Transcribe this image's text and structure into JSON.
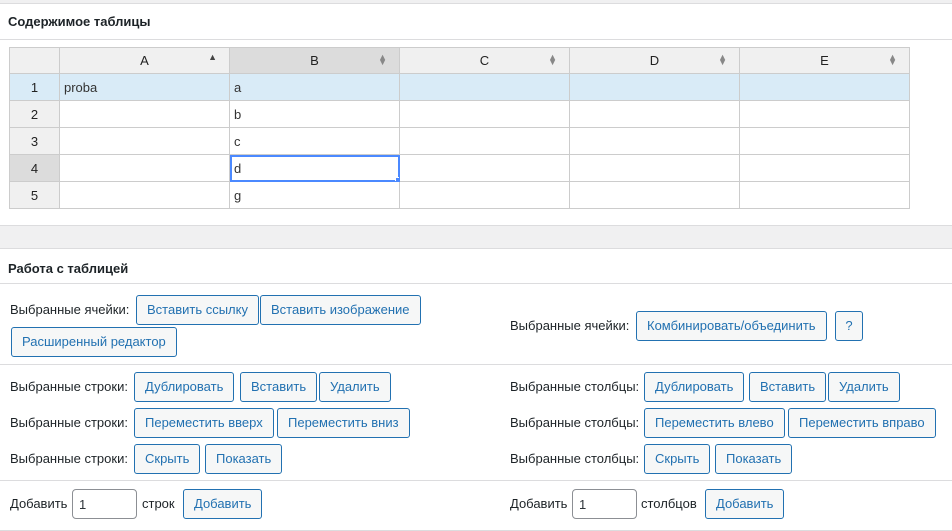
{
  "contents": {
    "title": "Содержимое таблицы",
    "columns": [
      "A",
      "B",
      "C",
      "D",
      "E"
    ],
    "rows": [
      {
        "num": "1",
        "cells": [
          "proba",
          "a",
          "",
          "",
          ""
        ]
      },
      {
        "num": "2",
        "cells": [
          "",
          "b",
          "",
          "",
          ""
        ]
      },
      {
        "num": "3",
        "cells": [
          "",
          "c",
          "",
          "",
          ""
        ]
      },
      {
        "num": "4",
        "cells": [
          "",
          "d",
          "",
          "",
          ""
        ]
      },
      {
        "num": "5",
        "cells": [
          "",
          "g",
          "",
          "",
          ""
        ]
      }
    ]
  },
  "ops": {
    "title": "Работа с таблицей",
    "cells_label": "Выбранные ячейки:",
    "insert_link": "Вставить ссылку",
    "insert_image": "Вставить изображение",
    "advanced_editor": "Расширенный редактор",
    "cells_label_right": "Выбранные ячейки:",
    "merge": "Комбинировать/объединить",
    "help": "?",
    "rows_label": "Выбранные строки:",
    "cols_label": "Выбранные столбцы:",
    "duplicate": "Дублировать",
    "insert": "Вставить",
    "delete": "Удалить",
    "move_up": "Переместить вверх",
    "move_down": "Переместить вниз",
    "move_left": "Переместить влево",
    "move_right": "Переместить вправо",
    "hide": "Скрыть",
    "show": "Показать",
    "add_label": "Добавить",
    "add_rows_value": "1",
    "rows_unit": "строк",
    "add_button": "Добавить",
    "add_cols_value": "1",
    "cols_unit": "столбцов"
  }
}
